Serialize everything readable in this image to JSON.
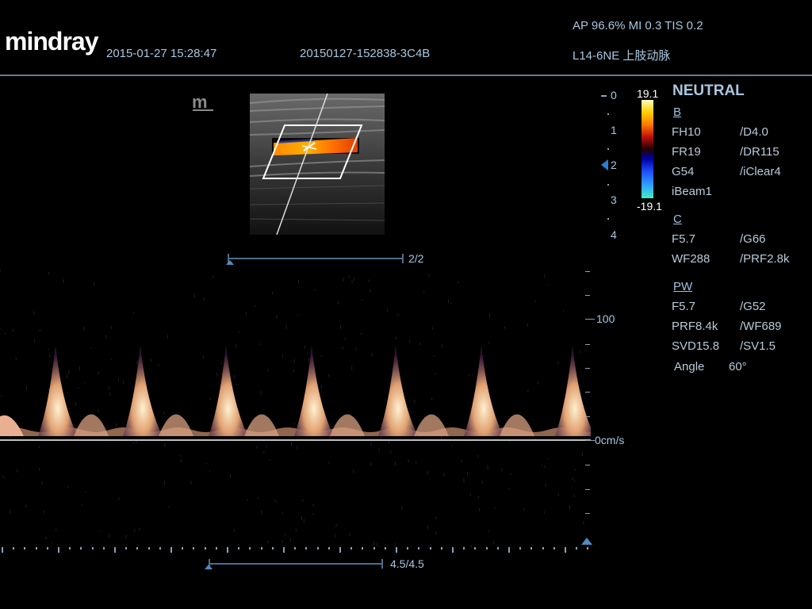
{
  "header": {
    "brand": "mindray",
    "datetime": "2015-01-27 15:28:47",
    "exam_id": "20150127-152838-3C4B",
    "power": "AP 96.6%  MI 0.3  TIS 0.2",
    "probe": "L14-6NE  上肢动脉"
  },
  "color_bar": {
    "max_label": "19.1",
    "min_label": "-19.1"
  },
  "depth_scale": {
    "marks": [
      "0",
      "1",
      "2",
      "3",
      "4"
    ]
  },
  "cine": {
    "top_label": "2/2",
    "bottom_label": "4.5/4.5"
  },
  "spectral": {
    "scale_100": "100",
    "baseline_label": "0cm/s"
  },
  "panel": {
    "title": "NEUTRAL",
    "b": {
      "heading": "B",
      "rows": [
        [
          "FH10",
          "/D4.0"
        ],
        [
          "FR19",
          "/DR115"
        ],
        [
          "G54",
          "/iClear4"
        ],
        [
          "iBeam1",
          ""
        ]
      ]
    },
    "c": {
      "heading": "C",
      "rows": [
        [
          "F5.7",
          "/G66"
        ],
        [
          "WF288",
          "/PRF2.8k"
        ]
      ]
    },
    "pw": {
      "heading": "PW",
      "rows": [
        [
          "F5.7",
          "/G52"
        ],
        [
          "PRF8.4k",
          "/WF689"
        ],
        [
          "SVD15.8",
          "/SV1.5"
        ]
      ]
    },
    "angle_label": "Angle",
    "angle_value": "60°"
  },
  "colors": {
    "background": "#000000",
    "text": "#a9c6df",
    "baseline": "#ffffff"
  }
}
